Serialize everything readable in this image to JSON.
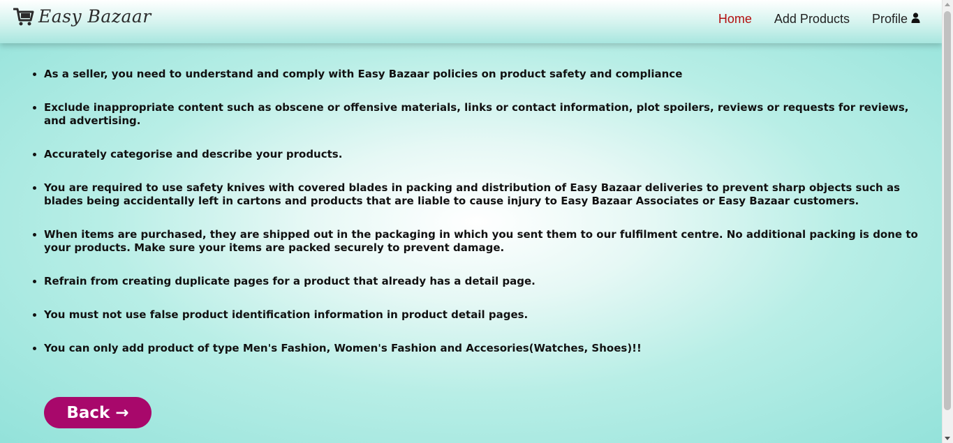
{
  "brand": {
    "name": "Easy Bazaar",
    "logo_icon": "shopping-cart-icon"
  },
  "nav": {
    "items": [
      {
        "label": "Home",
        "active": true
      },
      {
        "label": "Add Products",
        "active": false
      },
      {
        "label": "Profile",
        "active": false,
        "icon": "user-icon"
      }
    ],
    "active_color": "#b30f0f"
  },
  "rules": [
    "As a seller, you need to understand and comply with Easy Bazaar policies on product safety and compliance",
    "Exclude inappropriate content such as obscene or offensive materials, links or contact information, plot spoilers, reviews or requests for reviews, and advertising.",
    "Accurately categorise and describe your products.",
    "You are required to use safety knives with covered blades in packing and distribution of Easy Bazaar deliveries to prevent sharp objects such as blades being accidentally left in cartons and products that are liable to cause injury to Easy Bazaar Associates or Easy Bazaar customers.",
    "When items are purchased, they are shipped out in the packaging in which you sent them to our fulfilment centre. No additional packing is done to your products. Make sure your items are packed securely to prevent damage.",
    "Refrain from creating duplicate pages for a product that already has a detail page.",
    "You must not use false product identification information in product detail pages.",
    "You can only add product of type Men's Fashion, Women's Fashion and Accesories(Watches, Shoes)!!"
  ],
  "back_button": {
    "label": "Back →",
    "color": "#a8086b"
  }
}
